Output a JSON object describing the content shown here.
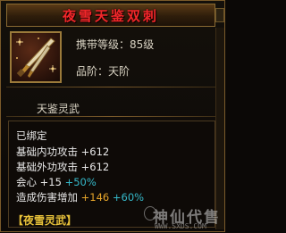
{
  "item": {
    "name": "夜雪天鉴双刺",
    "carry_level": "携带等级：85级",
    "quality": "品阶：天阶",
    "category": "天鉴灵武",
    "icon": "dual-daggers-icon"
  },
  "status": "已绑定",
  "attributes": [
    {
      "label": "基础内功攻击",
      "value": "+612",
      "bonus": ""
    },
    {
      "label": "基础外功攻击",
      "value": "+612",
      "bonus": ""
    },
    {
      "label": "会心",
      "value": "+15",
      "bonus": "+50%"
    },
    {
      "label": "造成伤害增加",
      "value": "+146",
      "bonus": "+60%"
    }
  ],
  "set_title": "【夜雪灵武】",
  "watermark": {
    "text": "神仙代售",
    "url": "WWW.SXDS.COM"
  },
  "colors": {
    "title": "#f0272a",
    "bonus": "#35b8c9",
    "set_title": "#e8c23a"
  }
}
